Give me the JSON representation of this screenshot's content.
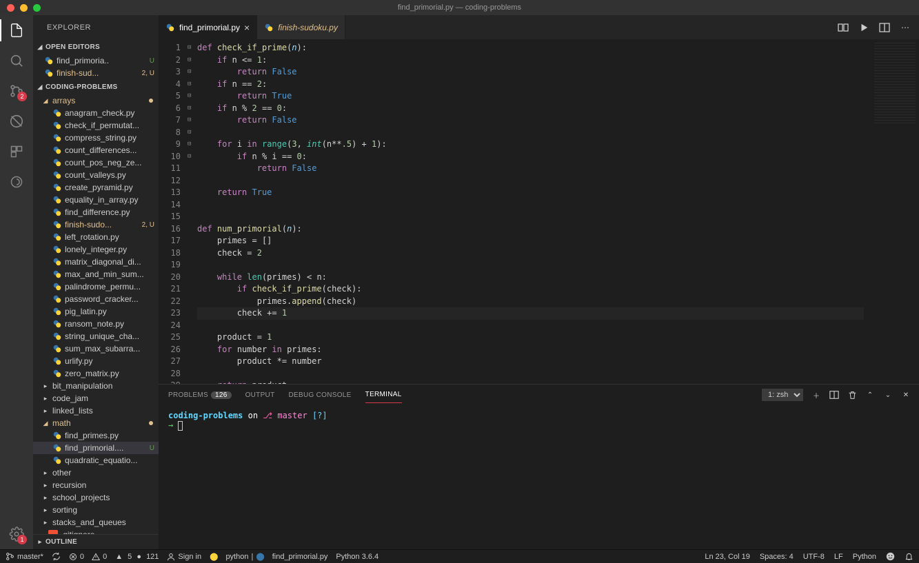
{
  "title": "find_primorial.py — coding-problems",
  "activitybar": {
    "scm_badge": "2",
    "settings_badge": "1"
  },
  "sidebar": {
    "header": "EXPLORER",
    "open_editors_label": "OPEN EDITORS",
    "open_editors": [
      {
        "name": "find_primoria..",
        "suffix": "U",
        "modified": false
      },
      {
        "name": "finish-sud...",
        "suffix": "2, U",
        "modified": true
      }
    ],
    "project_label": "CODING-PROBLEMS",
    "folders": {
      "arrays": {
        "label": "arrays",
        "modified": true,
        "files": [
          "anagram_check.py",
          "check_if_permutat...",
          "compress_string.py",
          "count_differences...",
          "count_pos_neg_ze...",
          "count_valleys.py",
          "create_pyramid.py",
          "equality_in_array.py",
          "find_difference.py",
          {
            "name": "finish-sudo...",
            "suffix": "2, U",
            "modified": true
          },
          "left_rotation.py",
          "lonely_integer.py",
          "matrix_diagonal_di...",
          "max_and_min_sum...",
          "palindrome_permu...",
          "password_cracker...",
          "pig_latin.py",
          "ransom_note.py",
          "string_unique_cha...",
          "sum_max_subarra...",
          "urlify.py",
          "zero_matrix.py"
        ]
      },
      "bit_manipulation": "bit_manipulation",
      "code_jam": "code_jam",
      "linked_lists": "linked_lists",
      "math": {
        "label": "math",
        "modified": true,
        "files": [
          "find_primes.py",
          {
            "name": "find_primorial....",
            "suffix": "U",
            "active": true
          },
          "quadratic_equatio..."
        ]
      },
      "other": "other",
      "recursion": "recursion",
      "school_projects": "school_projects",
      "sorting": "sorting",
      "stacks_and_queues": "stacks_and_queues",
      "gitignore": ".gitignore"
    },
    "outline_label": "OUTLINE"
  },
  "tabs": [
    {
      "name": "find_primorial.py",
      "active": true
    },
    {
      "name": "finish-sudoku.py",
      "italic": true
    }
  ],
  "code": {
    "lines": [
      {
        "n": 1,
        "fold": "⊟",
        "html": "<span class='kw'>def</span> <span class='fn'>check_if_prime</span>(<span class='par it'>n</span>):"
      },
      {
        "n": 2,
        "fold": "⊟",
        "html": "    <span class='kw'>if</span> n <span class='op'>&lt;=</span> <span class='num'>1</span>:"
      },
      {
        "n": 3,
        "html": "        <span class='kw'>return</span> <span class='bool'>False</span>"
      },
      {
        "n": 4,
        "fold": "⊟",
        "html": "    <span class='kw'>if</span> n <span class='op'>==</span> <span class='num'>2</span>:"
      },
      {
        "n": 5,
        "html": "        <span class='kw'>return</span> <span class='bool'>True</span>"
      },
      {
        "n": 6,
        "fold": "⊟",
        "html": "    <span class='kw'>if</span> n <span class='op'>%</span> <span class='num'>2</span> <span class='op'>==</span> <span class='num'>0</span>:"
      },
      {
        "n": 7,
        "html": "        <span class='kw'>return</span> <span class='bool'>False</span>"
      },
      {
        "n": 8,
        "html": ""
      },
      {
        "n": 9,
        "fold": "⊟",
        "html": "    <span class='kw'>for</span> i <span class='kw'>in</span> <span class='bi'>range</span>(<span class='num'>3</span>, <span class='bi it'>int</span>(n<span class='op'>**</span><span class='num'>.5</span>) <span class='op'>+</span> <span class='num'>1</span>):"
      },
      {
        "n": 10,
        "fold": "⊟",
        "html": "        <span class='kw'>if</span> n <span class='op'>%</span> i <span class='op'>==</span> <span class='num'>0</span>:"
      },
      {
        "n": 11,
        "html": "            <span class='kw'>return</span> <span class='bool'>False</span>"
      },
      {
        "n": 12,
        "html": ""
      },
      {
        "n": 13,
        "html": "    <span class='kw'>return</span> <span class='bool'>True</span>"
      },
      {
        "n": 14,
        "html": ""
      },
      {
        "n": 15,
        "html": ""
      },
      {
        "n": 16,
        "fold": "⊟",
        "html": "<span class='kw'>def</span> <span class='fn'>num_primorial</span>(<span class='par it'>n</span>):"
      },
      {
        "n": 17,
        "html": "    primes <span class='op'>=</span> []"
      },
      {
        "n": 18,
        "html": "    check <span class='op'>=</span> <span class='num'>2</span>"
      },
      {
        "n": 19,
        "html": ""
      },
      {
        "n": 20,
        "fold": "⊟",
        "html": "    <span class='kw'>while</span> <span class='bi'>len</span>(primes) <span class='op'>&lt;</span> n:"
      },
      {
        "n": 21,
        "fold": "⊟",
        "html": "        <span class='kw'>if</span> <span class='fn'>check_if_prime</span>(check):"
      },
      {
        "n": 22,
        "html": "            primes.<span class='fn'>append</span>(check)"
      },
      {
        "n": 23,
        "html": "        check <span class='op'>+=</span> <span class='num'>1</span>"
      },
      {
        "n": 24,
        "html": ""
      },
      {
        "n": 25,
        "html": "    product <span class='op'>=</span> <span class='num'>1</span>"
      },
      {
        "n": 26,
        "fold": "⊟",
        "html": "    <span class='kw'>for</span> number <span class='kw'>in</span> primes:"
      },
      {
        "n": 27,
        "html": "        product <span class='op'>*=</span> number"
      },
      {
        "n": 28,
        "html": ""
      },
      {
        "n": 29,
        "html": "    <span class='kw'>return</span> product"
      }
    ]
  },
  "panel": {
    "problems": "PROBLEMS",
    "problems_count": "126",
    "output": "OUTPUT",
    "debug": "DEBUG CONSOLE",
    "terminal": "TERMINAL",
    "term_selector": "1: zsh",
    "prompt_path": "coding-problems",
    "prompt_on": "on",
    "prompt_branch": "master",
    "prompt_q": "[?]"
  },
  "statusbar": {
    "branch": "master*",
    "sync": "",
    "errors": "0",
    "warnings": "0",
    "triangle": "5",
    "circles": "121",
    "signin": "Sign in",
    "python_env": "python",
    "file": "find_primorial.py",
    "python_ver": "Python 3.6.4",
    "cursor": "Ln 23, Col 19",
    "spaces": "Spaces: 4",
    "enc": "UTF-8",
    "eol": "LF",
    "lang": "Python"
  }
}
